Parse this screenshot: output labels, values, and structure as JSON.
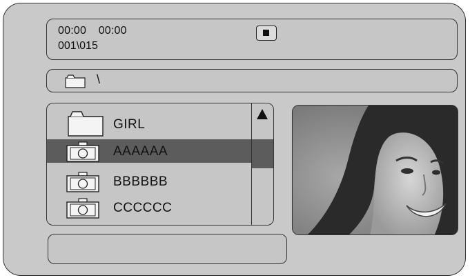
{
  "status": {
    "elapsed": "00:00",
    "total": "00:00",
    "track_counter": "001\\015",
    "stop_icon": "stop-icon"
  },
  "path": {
    "folder_icon": "folder-icon",
    "current_path": "\\"
  },
  "files": [
    {
      "type": "folder",
      "icon": "folder-icon",
      "name": "GIRL",
      "selected": false
    },
    {
      "type": "photo",
      "icon": "camera-icon",
      "name": "AAAAAA",
      "selected": true
    },
    {
      "type": "photo",
      "icon": "camera-icon",
      "name": "BBBBBB",
      "selected": false
    },
    {
      "type": "photo",
      "icon": "camera-icon",
      "name": "CCCCCC",
      "selected": false
    }
  ],
  "scrollbar": {
    "up_icon": "up-arrow-icon"
  },
  "preview": {
    "content": "photo thumbnail"
  },
  "info_bar": {
    "text": ""
  },
  "colors": {
    "background": "#c9c9c9",
    "highlight": "#5c5c5c",
    "border": "#333333"
  }
}
